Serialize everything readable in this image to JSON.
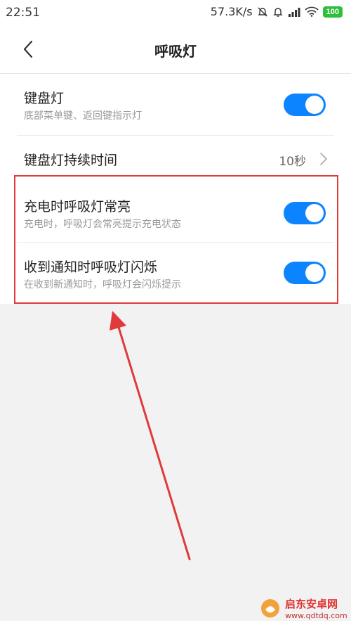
{
  "status_bar": {
    "time": "22:51",
    "network_speed": "57.3K/s",
    "battery": "100",
    "icons": [
      "mute-bell-icon",
      "alarm-icon",
      "signal-icon",
      "wifi-icon",
      "battery-icon"
    ]
  },
  "header": {
    "title": "呼吸灯",
    "back_icon": "chevron-left-icon"
  },
  "settings": [
    {
      "title": "键盘灯",
      "subtitle": "底部菜单键、返回键指示灯",
      "control": "toggle",
      "enabled": true
    },
    {
      "title": "键盘灯持续时间",
      "value": "10秒",
      "control": "chevron"
    },
    {
      "title": "充电时呼吸灯常亮",
      "subtitle": "充电时，呼吸灯会常亮提示充电状态",
      "control": "toggle",
      "enabled": true
    },
    {
      "title": "收到通知时呼吸灯闪烁",
      "subtitle": "在收到新通知时，呼吸灯会闪烁提示",
      "control": "toggle",
      "enabled": true
    }
  ],
  "colors": {
    "toggle_on": "#0d84ff",
    "annotation": "#e03a3a",
    "page_bg": "#f2f2f2"
  },
  "watermark": {
    "name": "启东安卓网",
    "url": "www.qdtdq.com"
  }
}
